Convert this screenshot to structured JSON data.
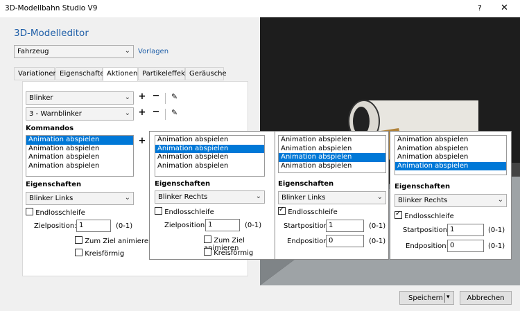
{
  "window": {
    "title": "3D-Modellbahn Studio V9",
    "help": "?",
    "close": "✕"
  },
  "editor": {
    "title": "3D-Modelleditor",
    "type_select": "Fahrzeug",
    "vorlagen_link": "Vorlagen"
  },
  "tabs": [
    "Variationen",
    "Eigenschaften",
    "Aktionen",
    "Partikeleffekte",
    "Geräusche"
  ],
  "panel": {
    "action_select": "Blinker",
    "sub_select": "3 - Warnblinker",
    "kommandos_label": "Kommandos",
    "commands": [
      "Animation abspielen",
      "Animation abspielen",
      "Animation abspielen",
      "Animation abspielen"
    ],
    "eigenschaften_label": "Eigenschaften",
    "target_select": "Blinker Links",
    "endlos_label": "Endlosschleife",
    "zielposition_label": "Zielposition:",
    "zielposition_value": "1",
    "range_label": "(0-1)",
    "zum_ziel_label": "Zum Ziel animieren",
    "kreisfoermig_label": "Kreisförmig"
  },
  "overlays": {
    "o1": {
      "commands": [
        "Animation abspielen",
        "Animation abspielen",
        "Animation abspielen",
        "Animation abspielen"
      ],
      "eigenschaften_label": "Eigenschaften",
      "target_select": "Blinker Rechts",
      "endlos_label": "Endlosschleife",
      "zielposition_label": "Zielposition:",
      "zielposition_value": "1",
      "range_label": "(0-1)",
      "zum_ziel_label": "Zum Ziel animieren",
      "kreisfoermig_label": "Kreisförmig"
    },
    "o2": {
      "commands": [
        "Animation abspielen",
        "Animation abspielen",
        "Animation abspielen",
        "Animation abspielen"
      ],
      "eigenschaften_label": "Eigenschaften",
      "target_select": "Blinker Links",
      "endlos_label": "Endlosschleife",
      "start_label": "Startposition:",
      "start_value": "1",
      "end_label": "Endposition:",
      "end_value": "0",
      "range_label": "(0-1)"
    },
    "o3": {
      "commands": [
        "Animation abspielen",
        "Animation abspielen",
        "Animation abspielen",
        "Animation abspielen"
      ],
      "eigenschaften_label": "Eigenschaften",
      "target_select": "Blinker Rechts",
      "endlos_label": "Endlosschleife",
      "start_label": "Startposition:",
      "start_value": "1",
      "end_label": "Endposition:",
      "end_value": "0",
      "range_label": "(0-1)"
    }
  },
  "footer": {
    "save": "Speichern",
    "cancel": "Abbrechen"
  },
  "colors": {
    "accent": "#0078d7",
    "title_blue": "#1f5fa8"
  }
}
